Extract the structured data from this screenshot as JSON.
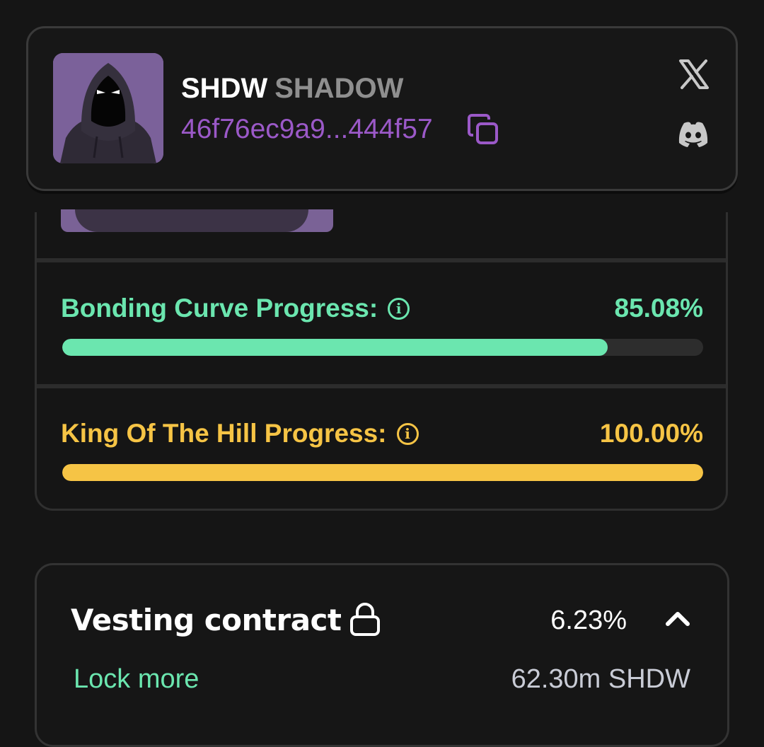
{
  "token": {
    "symbol": "SHDW",
    "name": "SHADOW",
    "address": "46f76ec9a9...444f57",
    "address_color": "#9b59c8"
  },
  "icons": {
    "copy": "copy-icon",
    "x": "x-twitter-icon",
    "discord": "discord-icon",
    "info": "info-icon",
    "lock": "lock-icon",
    "chevron": "chevron-up-icon"
  },
  "bonding_curve": {
    "label": "Bonding Curve Progress:",
    "percent_text": "85.08%",
    "progress": 0.8508,
    "color": "#6be6af"
  },
  "king_of_the_hill": {
    "label": "King Of The Hill Progress:",
    "percent_text": "100.00%",
    "progress": 1.0,
    "color": "#f6c445"
  },
  "vesting": {
    "title": "Vesting contract",
    "percent": "6.23%",
    "lock_more_label": "Lock more",
    "amount": "62.30m SHDW"
  }
}
